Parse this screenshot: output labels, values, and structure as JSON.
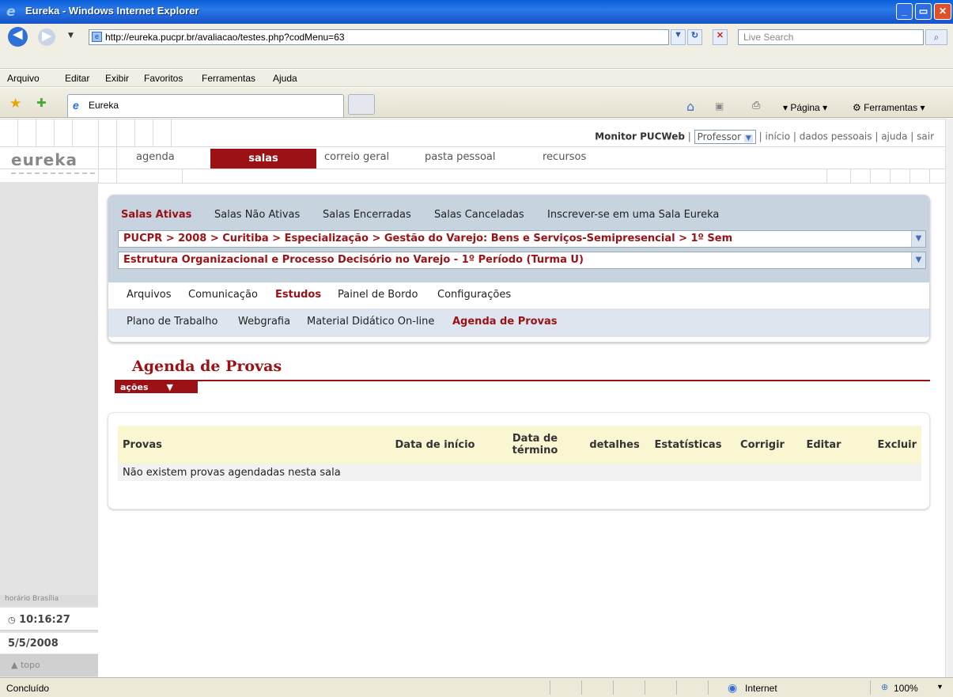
{
  "browser": {
    "window_title": "Eureka - Windows Internet Explorer",
    "address": "http://eureka.pucpr.br/avaliacao/testes.php?codMenu=63",
    "search_placeholder": "Live Search",
    "menu": [
      "Arquivo",
      "Editar",
      "Exibir",
      "Favoritos",
      "Ferramentas",
      "Ajuda"
    ],
    "tab_title": "Eureka",
    "toolbar_right": {
      "page": "Página",
      "tools": "Ferramentas"
    },
    "status": {
      "left": "Concluído",
      "zone": "Internet",
      "zoom": "100%"
    }
  },
  "header": {
    "monitor": "Monitor PUCWeb",
    "role": "Professor",
    "links": "início | dados pessoais | ajuda | sair",
    "logo": "eureka",
    "nav": [
      "agenda",
      "salas",
      "correio geral",
      "pasta pessoal",
      "recursos"
    ]
  },
  "sidebar": {
    "clock_label": "horário Brasília",
    "time": "10:16:27",
    "date": "5/5/2008",
    "top_link": "topo"
  },
  "rooms": {
    "tabs": [
      "Salas Ativas",
      "Salas Não Ativas",
      "Salas Encerradas",
      "Salas Canceladas",
      "Inscrever-se em uma Sala Eureka"
    ],
    "course_select": "PUCPR > 2008 > Curitiba > Especialização > Gestão do Varejo: Bens e Serviços-Semipresencial > 1º Sem",
    "class_select": "Estrutura Organizacional e Processo Decisório no Varejo - 1º Período (Turma U)",
    "subnav1": [
      "Arquivos",
      "Comunicação",
      "Estudos",
      "Painel de Bordo",
      "Configurações"
    ],
    "subnav2": [
      "Plano de Trabalho",
      "Webgrafia",
      "Material Didático On-line",
      "Agenda de Provas"
    ]
  },
  "agenda": {
    "title": "Agenda de Provas",
    "actions": "ações",
    "columns": [
      "Provas",
      "Data de início",
      "Data de término",
      "detalhes",
      "Estatísticas",
      "Corrigir",
      "Editar",
      "Excluir"
    ],
    "empty_message": "Não existem provas agendadas nesta sala"
  },
  "colors": {
    "accent": "#9b1116",
    "panel": "#c7d3df",
    "table_header": "#faf6d2"
  }
}
